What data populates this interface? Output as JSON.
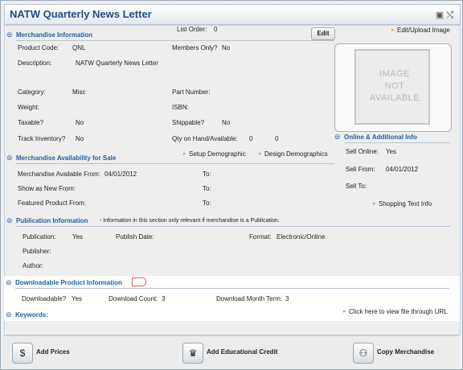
{
  "title": "NATW Quarterly News Letter",
  "merch_info": {
    "header": "Merchandise Information",
    "list_order_label": "List Order:",
    "list_order_value": "0",
    "edit_label": "Edit",
    "edit_upload_label": "Edit/Upload Image",
    "product_code_label": "Product Code:",
    "product_code_value": "QNL",
    "members_only_label": "Members Only?",
    "members_only_value": "No",
    "description_label": "Description:",
    "description_value": "NATW Quarterly News Letter",
    "category_label": "Category:",
    "category_value": "Misc",
    "part_number_label": "Part Number:",
    "weight_label": "Weight:",
    "isbn_label": "ISBN:",
    "taxable_label": "Taxable?",
    "taxable_value": "No",
    "shippable_label": "Shippable?",
    "shippable_value": "No",
    "track_inventory_label": "Track Inventory?",
    "track_inventory_value": "No",
    "qty_label": "Qty on Hand/Available:",
    "qty_on_hand": "0",
    "qty_available": "0"
  },
  "image_placeholder": {
    "line1": "IMAGE",
    "line2": "NOT",
    "line3": "AVAILABLE"
  },
  "online_info": {
    "header": "Online & Additional Info",
    "sell_online_label": "Sell Online:",
    "sell_online_value": "Yes",
    "sell_from_label": "Sell From:",
    "sell_from_value": "04/01/2012",
    "sell_to_label": "Sell To:",
    "shopping_text_label": "Shopping Text Info"
  },
  "availability": {
    "header": "Merchandise Availability for Sale",
    "setup_demographic": "Setup Demographic",
    "design_demographics": "Design Demographics",
    "available_from_label": "Merchandise Available From:",
    "available_from_value": "04/01/2012",
    "to_label": "To:",
    "show_new_label": "Show as New From:",
    "featured_label": "Featured Product From:"
  },
  "publication": {
    "header": "Publication Information",
    "note": "- Information in this section only relevant if merchandise is a Publication.",
    "publication_label": "Publication:",
    "publication_value": "Yes",
    "publish_date_label": "Publish Date:",
    "format_label": "Format:",
    "format_value": "Electronic/Online",
    "publisher_label": "Publisher:",
    "author_label": "Author:"
  },
  "downloadable": {
    "header": "Downloadable Product Information",
    "downloadable_label": "Downloadable?",
    "downloadable_value": "Yes",
    "download_count_label": "Download Count:",
    "download_count_value": "3",
    "download_term_label": "Download Month Term:",
    "download_term_value": "3"
  },
  "keywords": {
    "header": "Keywords:",
    "view_file_label": "Click here to view file through URL"
  },
  "actions": {
    "add_prices": "Add Prices",
    "add_educational_credit": "Add Educational Credit",
    "copy_merchandise": "Copy Merchandise"
  },
  "colors": {
    "header_blue": "#1f5fa6",
    "arrow_orange": "#f39a1c",
    "title_blue": "#1f4c8a"
  }
}
